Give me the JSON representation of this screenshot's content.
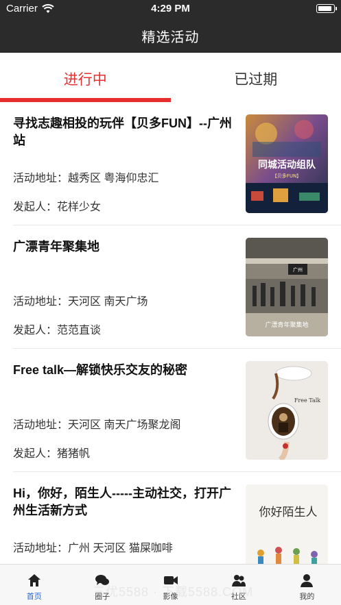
{
  "status_bar": {
    "carrier": "Carrier",
    "time": "4:29 PM",
    "battery_level": 0.95
  },
  "nav": {
    "title": "精选活动"
  },
  "tabs": [
    {
      "label": "进行中",
      "active": true
    },
    {
      "label": "已过期",
      "active": false
    }
  ],
  "activities": [
    {
      "title": "寻找志趣相投的玩伴【贝多FUN】--广州站",
      "address": "活动地址：越秀区 粤海仰忠汇",
      "host": "发起人：花样少女",
      "poster_text": "同城活动组队",
      "poster_sub": "【贝多FUN】"
    },
    {
      "title": "广漂青年聚集地",
      "address": "活动地址：天河区 南天广场",
      "host": "发起人：范范直谈",
      "poster_text": "广漂青年聚集地",
      "poster_sub": "广州"
    },
    {
      "title": "Free talk—解锁快乐交友的秘密",
      "address": "活动地址：天河区 南天广场聚龙阁",
      "host": "发起人：猪猪帆",
      "poster_text": "Free Talk",
      "poster_sub": ""
    },
    {
      "title": "Hi，你好，陌生人-----主动社交，打开广州生活新方式",
      "address": "活动地址：广州 天河区 猫屎咖啡",
      "host": "",
      "poster_text": "你好陌生人",
      "poster_sub": ""
    }
  ],
  "tabbar": [
    {
      "label": "首页",
      "icon": "home-icon",
      "active": true
    },
    {
      "label": "圈子",
      "icon": "chat-bubbles-icon",
      "active": false
    },
    {
      "label": "影像",
      "icon": "video-camera-icon",
      "active": false
    },
    {
      "label": "社区",
      "icon": "community-icon",
      "active": false
    },
    {
      "label": "我的",
      "icon": "user-icon",
      "active": false
    }
  ],
  "watermark": "三优5588 · 下载5588.COM",
  "colors": {
    "accent": "#e62e2e",
    "header_bg": "#2b2b2b",
    "tabbar_active": "#2a66d9"
  }
}
